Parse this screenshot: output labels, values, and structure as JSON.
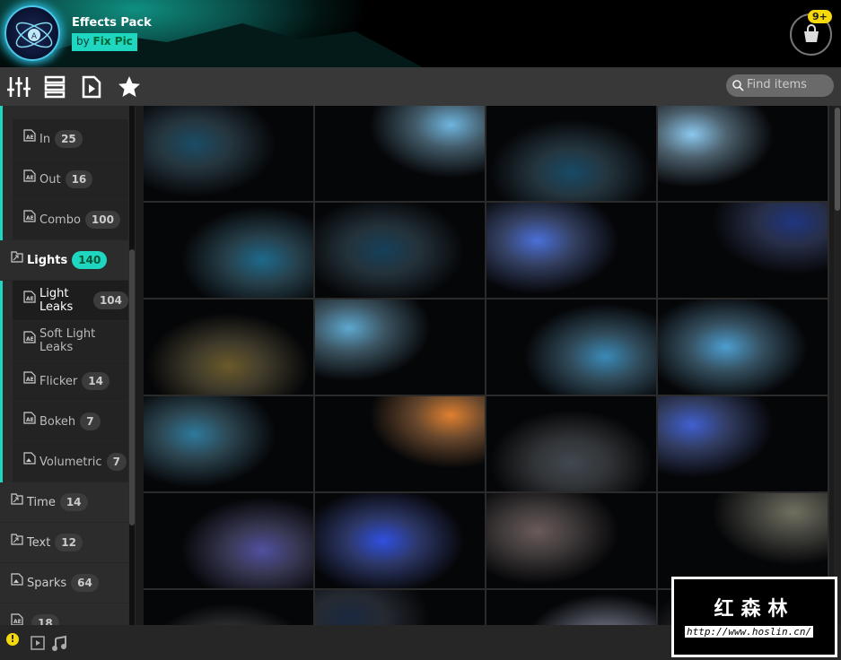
{
  "header": {
    "title": "Effects Pack",
    "by": "by",
    "author": "Fix Pic",
    "cart_badge": "9+"
  },
  "toolbar": {
    "search_placeholder": "Find items"
  },
  "sidebar": {
    "items": [
      {
        "label": "In",
        "count": "25",
        "type": "ae",
        "level": "sub"
      },
      {
        "label": "Out",
        "count": "16",
        "type": "ae",
        "level": "sub"
      },
      {
        "label": "Combo",
        "count": "100",
        "type": "ae",
        "level": "sub"
      },
      {
        "label": "Lights",
        "count": "140",
        "type": "folder",
        "level": "parent",
        "active": true
      },
      {
        "label": "Light Leaks",
        "count": "104",
        "type": "ae",
        "level": "sub",
        "selected": true
      },
      {
        "label": "Soft Light Leaks",
        "count": "",
        "type": "ae",
        "level": "sub"
      },
      {
        "label": "Flicker",
        "count": "14",
        "type": "ae",
        "level": "sub"
      },
      {
        "label": "Bokeh",
        "count": "7",
        "type": "ae",
        "level": "sub"
      },
      {
        "label": "Volumetric",
        "count": "7",
        "type": "image",
        "level": "sub"
      },
      {
        "label": "Time",
        "count": "14",
        "type": "folder",
        "level": "top"
      },
      {
        "label": "Text",
        "count": "12",
        "type": "folder",
        "level": "top"
      },
      {
        "label": "Sparks",
        "count": "64",
        "type": "image",
        "level": "top"
      },
      {
        "label": "",
        "count": "18",
        "type": "ae",
        "level": "top"
      }
    ]
  },
  "watermark": {
    "brand": "红森林",
    "url": "http://www.hoslin.cn/"
  },
  "thumbnail_colors": [
    "#1a4c66",
    "#6fb6e0",
    "#164a66",
    "#8cc8ee",
    "#1d6a8c",
    "#15405a",
    "#4a6fd8",
    "#1f3580",
    "#6a5a2a",
    "#5ea8d0",
    "#3a8ab8",
    "#4c9ed0",
    "#2f7a9c",
    "#e08030",
    "#404850",
    "#4060d0",
    "#5050a0",
    "#3050e0",
    "#6a5a5a",
    "#707060",
    "#505860",
    "#1a2840",
    "#b0b8e0",
    "#303040"
  ]
}
